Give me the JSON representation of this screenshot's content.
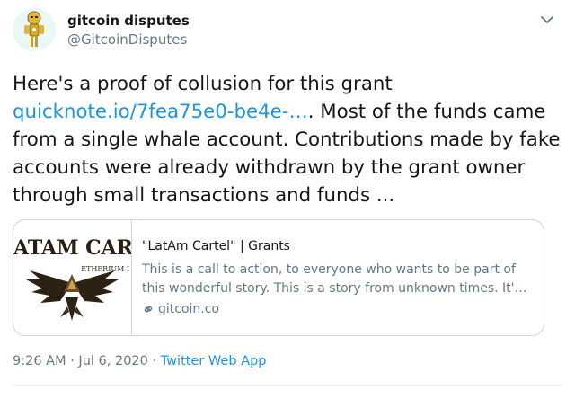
{
  "author": {
    "display_name": "gitcoin disputes",
    "handle": "@GitcoinDisputes"
  },
  "tweet": {
    "text_before_link": "Here's a proof of collusion for this grant ",
    "link_text": "quicknote.io/7fea75e0-be4e-…",
    "text_after_link": ". Most of the funds came from a single whale account. Contributions made by fake accounts were already withdrawn by the grant owner through small transactions and funds ..."
  },
  "card": {
    "image_text_top": "ATAM CART",
    "image_text_sub": "ETHERIUM I",
    "title": "\"LatAm Cartel\" | Grants",
    "description_line1": "This is a call to action, to everyone who wants to be part of",
    "description_line2": "this wonderful story. This is a story from unknown times. It'…",
    "domain": "gitcoin.co"
  },
  "meta": {
    "timestamp": "9:26 AM · Jul 6, 2020",
    "separator": " · ",
    "source": "Twitter Web App"
  },
  "icons": {
    "caret": "chevron-down-icon",
    "link": "link-icon"
  },
  "colors": {
    "link": "#1b95e0",
    "secondary_text": "#657786",
    "border": "#ccd6dd"
  }
}
